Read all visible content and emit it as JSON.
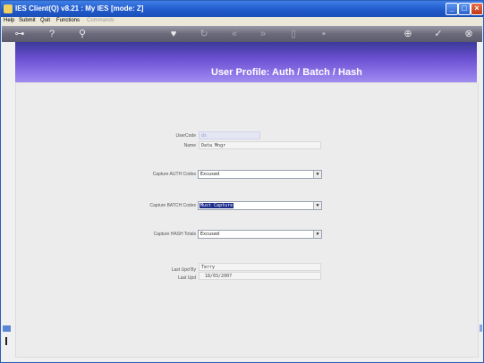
{
  "window": {
    "title": "IES Client(Q) v8.21 : My IES :",
    "mode": "[mode: Z]"
  },
  "menu": {
    "items": [
      "Help",
      "Submit",
      "Quit",
      "Functions"
    ],
    "disabled_item": "Commands"
  },
  "toolbar": {
    "icons": [
      "key-icon",
      "help-icon",
      "search-icon",
      "heart-icon",
      "refresh-icon",
      "back-icon",
      "forward-icon",
      "document-icon",
      "save-icon",
      "add-icon",
      "check-icon",
      "close-icon"
    ]
  },
  "page": {
    "title": "User Profile: Auth / Batch / Hash"
  },
  "form": {
    "user_code_label": "UserCode",
    "user_code_value": "ds",
    "name_label": "Name",
    "name_value": "Data Mngr",
    "auth_label": "Capture AUTH Codes",
    "auth_value": "Excused",
    "batch_label": "Capture BATCH Codes",
    "batch_value": "Must Capture",
    "hash_label": "Capture HASH Totals",
    "hash_value": "Excused",
    "last_upd_by_label": "Last Upd By",
    "last_upd_by_value": "Terry",
    "last_upd_label": "Last Upd",
    "last_upd_value": "18/03/2007"
  },
  "colors": {
    "title_bar": "#1f58c9",
    "header_band": "#6a4fd0",
    "selection": "#1c2d8a"
  }
}
